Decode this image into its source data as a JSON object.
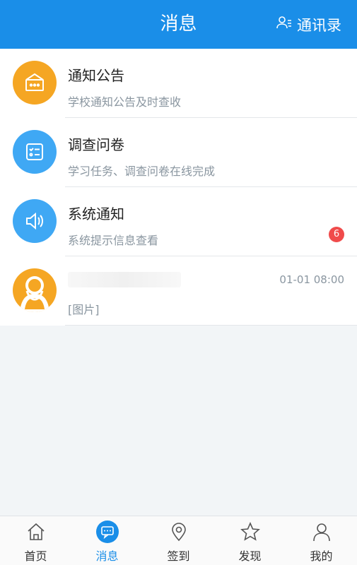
{
  "header": {
    "title": "消息",
    "contacts_label": "通讯录",
    "accent": "#1a8ee8"
  },
  "messages": [
    {
      "title": "通知公告",
      "subtitle": "学校通知公告及时查收",
      "icon": "announcement-icon",
      "icon_color": "#f5a623"
    },
    {
      "title": "调查问卷",
      "subtitle": "学习任务、调查问卷在线完成",
      "icon": "checklist-icon",
      "icon_color": "#3fa8f4"
    },
    {
      "title": "系统通知",
      "subtitle": "系统提示信息查看",
      "icon": "speaker-icon",
      "icon_color": "#3fa8f4",
      "badge": "6",
      "badge_color": "#f04b4b"
    },
    {
      "title": "",
      "subtitle": "[图片]",
      "time": "01-01 08:00",
      "icon": "avatar-icon",
      "icon_color": "#f5a623"
    }
  ],
  "tabbar": {
    "items": [
      {
        "label": "首页",
        "icon": "home-icon"
      },
      {
        "label": "消息",
        "icon": "chat-icon",
        "active": true
      },
      {
        "label": "签到",
        "icon": "location-pin-icon"
      },
      {
        "label": "发现",
        "icon": "star-icon"
      },
      {
        "label": "我的",
        "icon": "user-icon"
      }
    ]
  }
}
